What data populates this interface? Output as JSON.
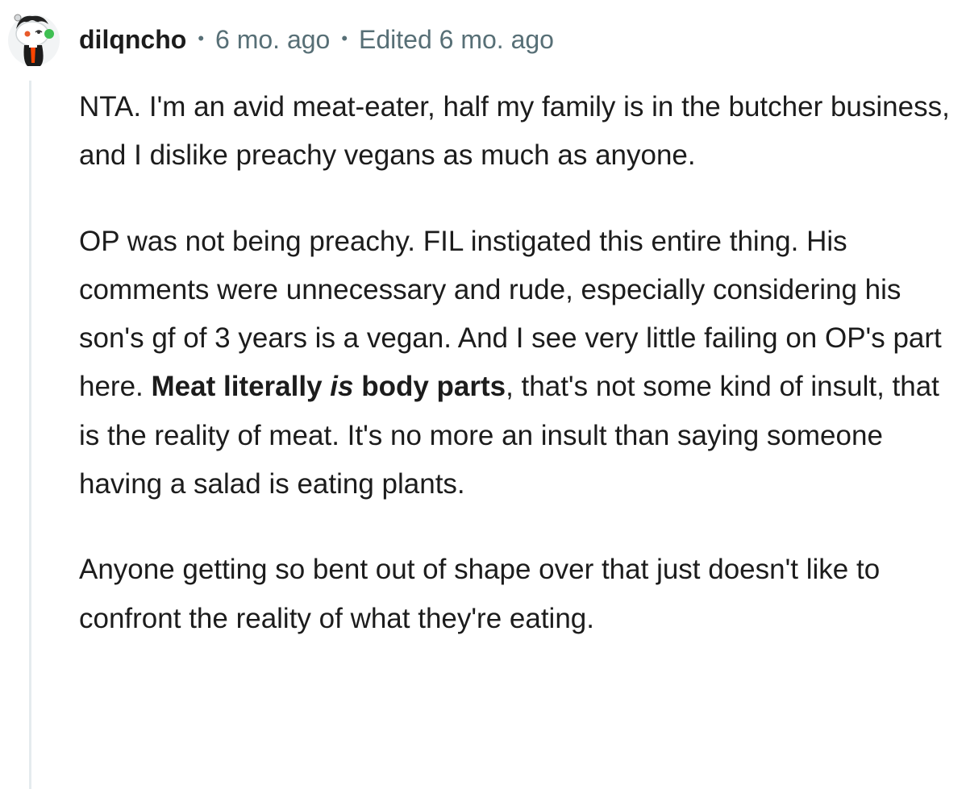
{
  "comment": {
    "username": "dilqncho",
    "separator": "•",
    "time": "6 mo. ago",
    "edited": "Edited 6 mo. ago",
    "paragraphs": {
      "p1": {
        "text": "NTA. I'm an avid meat-eater, half my family is in the butcher business, and I dislike preachy vegans as much as anyone."
      },
      "p2": {
        "lead": "OP was not being preachy. FIL instigated this entire thing. His comments were unnecessary and rude, especially considering his son's gf of 3 years is a vegan. And I see very little failing on OP's part here. ",
        "bold_a": "Meat literally ",
        "bold_italic": "is",
        "bold_b": " body parts",
        "tail": ", that's not some kind of insult, that is the reality of meat. It's no more an insult than saying someone having a salad is eating plants."
      },
      "p3": {
        "text": "Anyone getting so bent out of shape over that just doesn't like to confront the reality of what they're eating."
      }
    }
  }
}
